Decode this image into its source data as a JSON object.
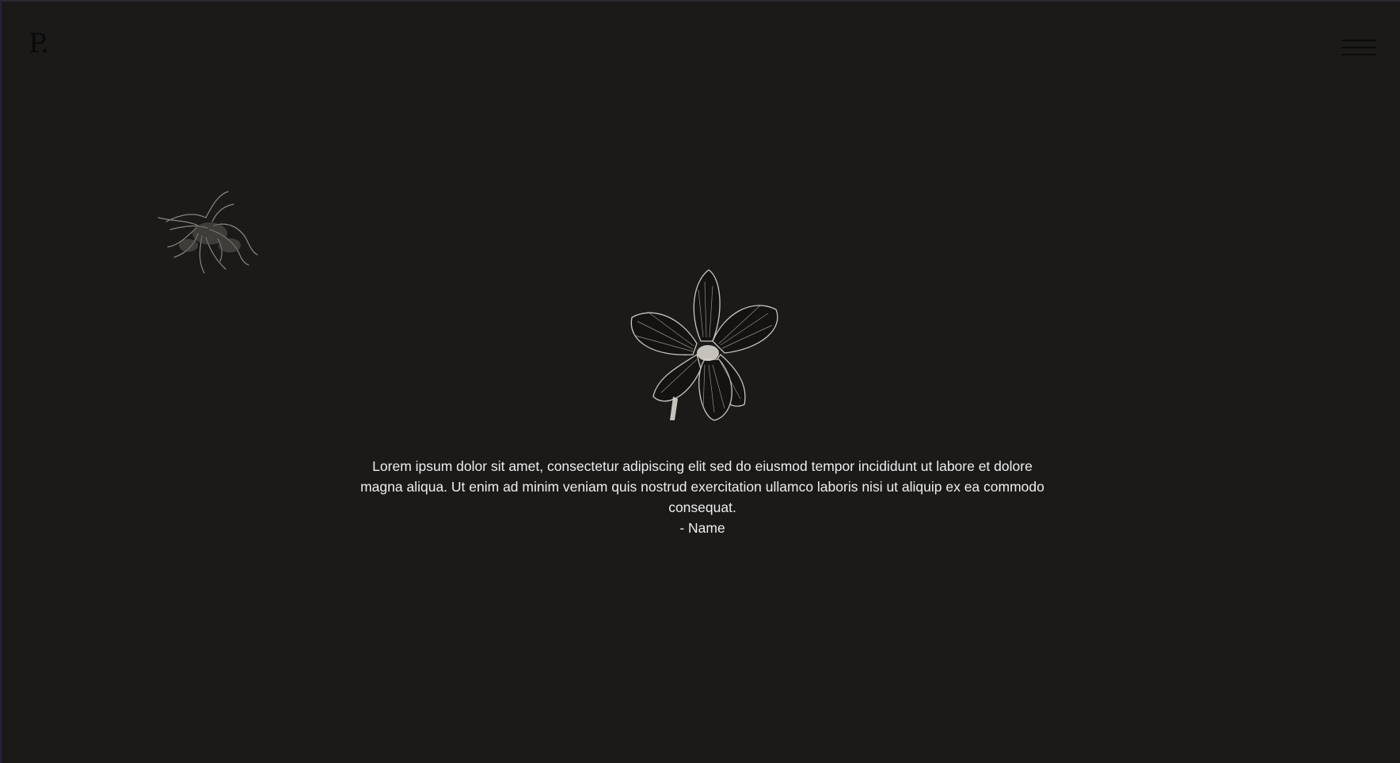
{
  "header": {
    "logo_text": "P.",
    "menu_icon": "hamburger-menu-icon"
  },
  "decorations": {
    "small_flower": "lily-flower-icon",
    "large_flower": "orchid-flower-icon"
  },
  "testimonial": {
    "quote": "Lorem ipsum dolor sit amet, consectetur adipiscing elit sed do eiusmod tempor incididunt ut labore et dolore magna aliqua. Ut enim ad minim veniam quis nostrud exercitation ullamco laboris nisi ut aliquip ex ea commodo consequat.",
    "author": "- Name"
  },
  "colors": {
    "background": "#1b1a19",
    "text": "#eeeeee"
  }
}
